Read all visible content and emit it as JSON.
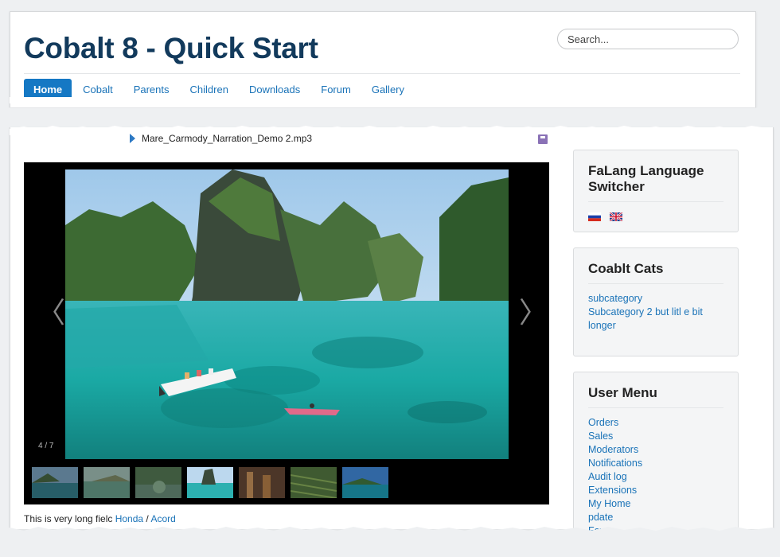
{
  "header": {
    "site_title": "Cobalt 8 - Quick Start",
    "search_placeholder": "Search..."
  },
  "nav": {
    "items": [
      {
        "label": "Home",
        "active": true
      },
      {
        "label": "Cobalt"
      },
      {
        "label": "Parents"
      },
      {
        "label": "Children"
      },
      {
        "label": "Downloads"
      },
      {
        "label": "Forum"
      },
      {
        "label": "Gallery"
      }
    ]
  },
  "content": {
    "audio_file": "Mare_Carmody_Narration_Demo 2.mp3",
    "gallery": {
      "counter": "4 / 7",
      "prev_symbol": "〈",
      "next_symbol": "〉",
      "thumb_count": 7,
      "active_thumb": 4
    },
    "field_text": "This is very long fielc",
    "field_links": {
      "first": "Honda",
      "separator": " / ",
      "second": "Acord"
    }
  },
  "sidebar": {
    "falang": {
      "title": "FaLang Language Switcher",
      "flags": [
        "ru-flag-icon",
        "uk-flag-icon"
      ]
    },
    "cobalt_cats": {
      "title": "Coablt Cats",
      "links": [
        "subcategory",
        "Subcategory 2 but litl e bit longer"
      ]
    },
    "user_menu": {
      "title": "User Menu",
      "links": [
        "Orders",
        "Sales",
        "Moderators",
        "Notifications",
        "Audit log",
        "Extensions",
        "My Home",
        "pdate",
        "Favor..."
      ]
    }
  },
  "colors": {
    "title": "#123a5c",
    "link": "#1a73b8",
    "nav_active": "#1578c4"
  }
}
